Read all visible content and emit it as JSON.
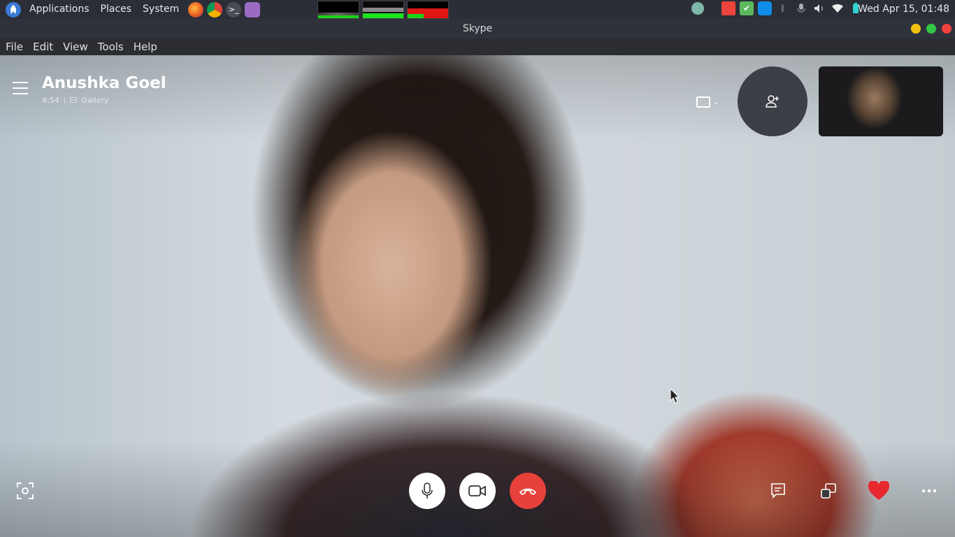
{
  "panel": {
    "menus": [
      "Applications",
      "Places",
      "System"
    ],
    "clock": "Wed Apr 15, 01:48",
    "launchers": [
      "firefox-icon",
      "chrome-icon",
      "terminal-icon",
      "text-editor-icon"
    ],
    "tray": [
      "updates-icon",
      "anydesk-icon",
      "checkmark-icon",
      "teamviewer-icon",
      "bluetooth-icon",
      "microphone-icon",
      "volume-icon",
      "wifi-icon",
      "battery-icon"
    ]
  },
  "window": {
    "title": "Skype",
    "menu": [
      "File",
      "Edit",
      "View",
      "Tools",
      "Help"
    ]
  },
  "call": {
    "contact_name": "Anushka Goel",
    "duration": "4:54",
    "layout_label": "Gallery",
    "controls": [
      "microphone-button",
      "video-button",
      "end-call-button"
    ],
    "right_controls": [
      "chat-button",
      "switch-view-button",
      "react-heart-button",
      "more-options-button"
    ]
  },
  "colors": {
    "end_call": "#e8413c",
    "heart": "#e8282f",
    "panel_bg": "#2b2e37",
    "titlebar_bg": "#2f323b",
    "menubar_bg": "#2b2d33"
  }
}
